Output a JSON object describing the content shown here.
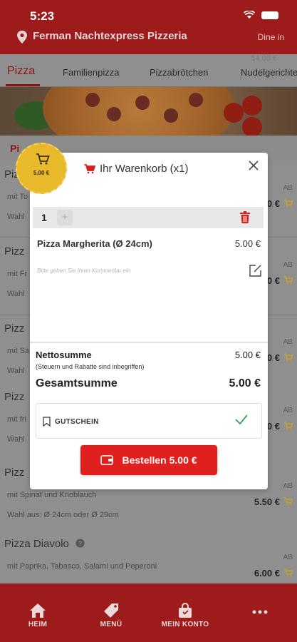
{
  "status_bar": {
    "time": "5:23"
  },
  "header": {
    "restaurant_name": "Ferman Nachtexpress Pizzeria",
    "mode": "Dine in"
  },
  "category_tabs": {
    "items": [
      {
        "label": "Pizza",
        "active": true
      },
      {
        "label": "Familienpizza",
        "active": false
      },
      {
        "label": "Pizzabrötchen",
        "active": false
      },
      {
        "label": "Nudelgerichte",
        "active": false
      }
    ],
    "ghost_price": "14.00 €"
  },
  "section": {
    "label": "Pi"
  },
  "menu_items": [
    {
      "name": "Pizz",
      "desc": "mit To",
      "size": "Wahl",
      "badge": "AB",
      "price": "0 €"
    },
    {
      "name": "Pizz",
      "desc": "mit Fr",
      "size": "Wahl",
      "badge": "AB",
      "price": "0 €"
    },
    {
      "name": "Pizz",
      "desc": "mit Sa",
      "size": "Wahl",
      "badge": "AB",
      "price": "0 €"
    },
    {
      "name": "Pizz",
      "desc": "mit fri",
      "size": "Wahl",
      "badge": "AB",
      "price": "0 €"
    },
    {
      "name": "Pizz",
      "desc": "mit Spinat und Knoblauch",
      "size": "Wahl aus: Ø 24cm oder Ø 29cm",
      "badge": "AB",
      "price": "5.50 €"
    },
    {
      "name": "Pizza Diavolo",
      "desc": "mit Paprika, Tabasco, Salami und Peperoni",
      "size": "",
      "badge": "AB",
      "price": "6.00 €"
    }
  ],
  "cart_badge": {
    "total": "5.00 €"
  },
  "cart_modal": {
    "title": "Ihr Warenkorb (x1)",
    "quantity": "1",
    "plus": "+",
    "item_name": "Pizza Margherita (Ø 24cm)",
    "item_price": "5.00 €",
    "comment_placeholder": "Bitte geben Sie Ihren Kommentar ein",
    "net_label": "Nettosumme",
    "net_value": "5.00 €",
    "net_note": "(Steuern und Rabatte sind inbegriffen)",
    "total_label": "Gesamtsumme",
    "total_value": "5.00 €",
    "voucher_label": "GUTSCHEIN",
    "order_button": "Bestellen 5.00 €"
  },
  "bottom_nav": [
    {
      "label": "HEIM",
      "icon": "home-icon"
    },
    {
      "label": "MENÜ",
      "icon": "tag-icon"
    },
    {
      "label": "MEIN KONTO",
      "icon": "bag-icon"
    },
    {
      "label": "",
      "icon": "more-icon"
    }
  ],
  "colors": {
    "brand_red": "#9e1b1b",
    "accent_red": "#e0201f",
    "badge_yellow": "#e9b92c",
    "check_green": "#3aa15a"
  }
}
